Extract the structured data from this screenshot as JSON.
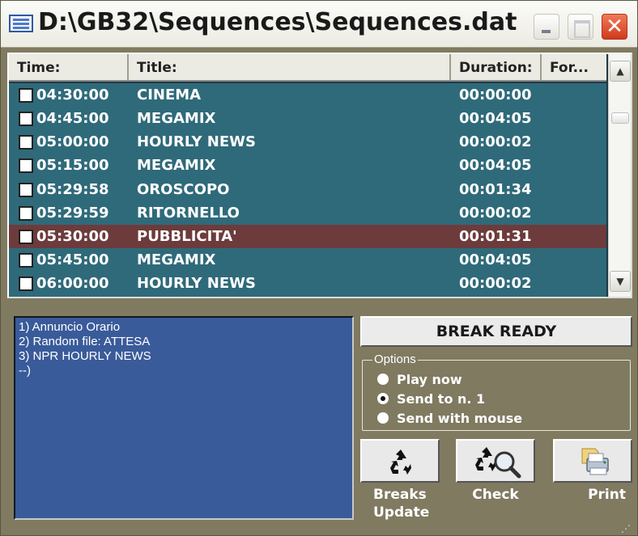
{
  "window": {
    "title": "D:\\GB32\\Sequences\\Sequences.dat",
    "close_glyph": "✕"
  },
  "table": {
    "columns": [
      "Time:",
      "Title:",
      "Duration:",
      "For..."
    ],
    "rows": [
      {
        "time": "04:30:00",
        "title": "CINEMA",
        "duration": "00:00:00",
        "selected": false
      },
      {
        "time": "04:45:00",
        "title": "MEGAMIX",
        "duration": "00:04:05",
        "selected": false
      },
      {
        "time": "05:00:00",
        "title": "HOURLY NEWS",
        "duration": "00:00:02",
        "selected": false
      },
      {
        "time": "05:15:00",
        "title": "MEGAMIX",
        "duration": "00:04:05",
        "selected": false
      },
      {
        "time": "05:29:58",
        "title": "OROSCOPO",
        "duration": "00:01:34",
        "selected": false
      },
      {
        "time": "05:29:59",
        "title": "RITORNELLO",
        "duration": "00:00:02",
        "selected": false
      },
      {
        "time": "05:30:00",
        "title": "PUBBLICITA'",
        "duration": "00:01:31",
        "selected": true
      },
      {
        "time": "05:45:00",
        "title": "MEGAMIX",
        "duration": "00:04:05",
        "selected": false
      },
      {
        "time": "06:00:00",
        "title": "HOURLY NEWS",
        "duration": "00:00:02",
        "selected": false
      }
    ]
  },
  "log": {
    "lines": [
      "1) Annuncio Orario",
      "2) Random file: ATTESA",
      "3) NPR HOURLY NEWS",
      "--)"
    ]
  },
  "status": {
    "break_ready": "BREAK READY"
  },
  "options": {
    "legend": "Options",
    "items": [
      {
        "label": "Play now",
        "checked": false
      },
      {
        "label": "Send to n. 1",
        "checked": true
      },
      {
        "label": "Send with mouse",
        "checked": false
      }
    ]
  },
  "actions": {
    "breaks_update_line1": "Breaks",
    "breaks_update_line2": "Update",
    "check": "Check",
    "print": "Print"
  },
  "icons": {
    "app": "app-list-icon",
    "recycle": "recycle-icon",
    "check": "recycle-magnifier-icon",
    "print": "printer-icon"
  },
  "colors": {
    "row_bg": "#2f6a7a",
    "selected_row_bg": "#6d3b3c",
    "log_bg": "#3a5b9a",
    "window_bg": "#7f7a60"
  }
}
